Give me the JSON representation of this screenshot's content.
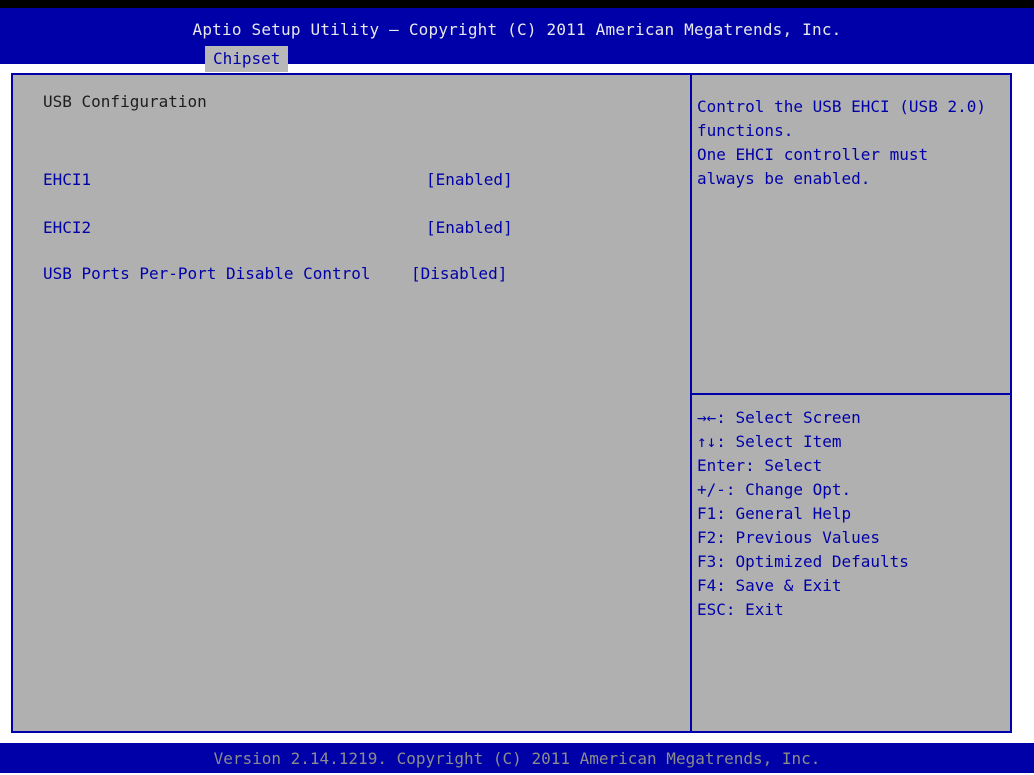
{
  "header": {
    "title": "Aptio Setup Utility – Copyright (C) 2011 American Megatrends, Inc.",
    "active_tab": "Chipset"
  },
  "main": {
    "heading": "USB Configuration",
    "items": [
      {
        "label": "EHCI1",
        "value": "[Enabled]"
      },
      {
        "label": "EHCI2",
        "value": "[Enabled]"
      },
      {
        "label": "USB Ports Per-Port Disable Control",
        "value": "[Disabled]"
      }
    ]
  },
  "help": {
    "text": "Control the USB EHCI (USB 2.0)\nfunctions.\nOne EHCI controller must\nalways be enabled."
  },
  "keys": [
    "→←: Select Screen",
    "↑↓: Select Item",
    "Enter: Select",
    "+/-: Change Opt.",
    "F1: General Help",
    "F2: Previous Values",
    "F3: Optimized Defaults",
    "F4: Save & Exit",
    "ESC: Exit"
  ],
  "footer": {
    "text": "Version 2.14.1219. Copyright (C) 2011 American Megatrends, Inc."
  },
  "colors": {
    "header_bg": "#0000a8",
    "panel_bg": "#b0b0b0",
    "item_text": "#0000a8",
    "tab_bg": "#b8b8b8"
  }
}
